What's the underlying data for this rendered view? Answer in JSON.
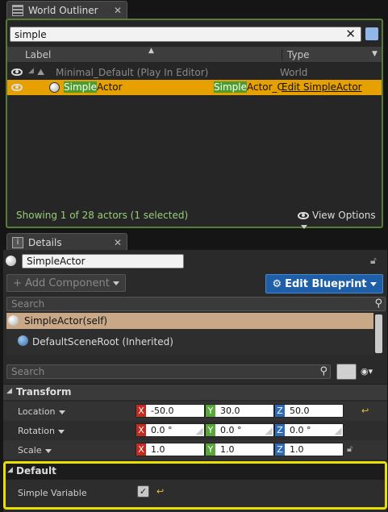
{
  "outliner": {
    "tab_title": "World Outliner",
    "search_value": "simple",
    "col_label": "Label",
    "col_type": "Type",
    "rows": [
      {
        "label": "Minimal_Default (Play In Editor)",
        "type": "World"
      },
      {
        "label_match": "Simple",
        "label_rest": "Actor",
        "type_match": "Simple",
        "type_rest": "Actor_C",
        "type_link": "Edit SimpleActor"
      }
    ],
    "status": "Showing 1 of 28 actors (1 selected)",
    "view_options": "View Options"
  },
  "details": {
    "tab_title": "Details",
    "actor_name": "SimpleActor",
    "add_component": "+ Add Component",
    "edit_blueprint": "Edit Blueprint",
    "comp_search_placeholder": "Search",
    "components": [
      "SimpleActor(self)",
      "DefaultSceneRoot (Inherited)"
    ],
    "prop_search_placeholder": "Search",
    "transform": {
      "title": "Transform",
      "location": {
        "label": "Location",
        "x": "-50.0",
        "y": "30.0",
        "z": "50.0"
      },
      "rotation": {
        "label": "Rotation",
        "x": "0.0 °",
        "y": "0.0 °",
        "z": "0.0 °"
      },
      "scale": {
        "label": "Scale",
        "x": "1.0",
        "y": "1.0",
        "z": "1.0"
      }
    },
    "default": {
      "title": "Default",
      "simple_variable_label": "Simple Variable",
      "simple_variable_checked": true
    },
    "axis": {
      "x": "X",
      "y": "Y",
      "z": "Z"
    }
  },
  "colors": {
    "accent_green": "#4b9d2e",
    "selected_row": "#e6a000",
    "blueprint_btn": "#1f5fa8",
    "highlight_yellow": "#e8e000"
  }
}
